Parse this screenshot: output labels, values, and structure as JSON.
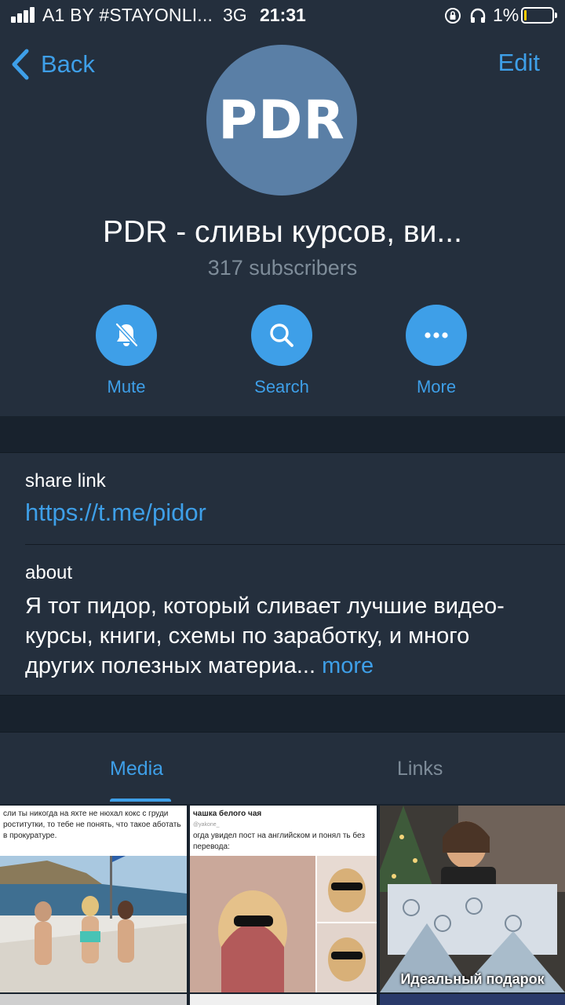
{
  "status_bar": {
    "carrier": "A1 BY #STAYONLI...",
    "network": "3G",
    "time": "21:31",
    "battery": "1%"
  },
  "header": {
    "back_label": "Back",
    "edit_label": "Edit",
    "avatar_text": "PDR",
    "title": "PDR - сливы курсов, ви...",
    "subscribers": "317 subscribers"
  },
  "actions": [
    {
      "label": "Mute",
      "icon": "bell-slash-icon"
    },
    {
      "label": "Search",
      "icon": "search-icon"
    },
    {
      "label": "More",
      "icon": "more-icon"
    }
  ],
  "info": {
    "share_caption": "share link",
    "share_url": "https://t.me/pidor",
    "about_caption": "about",
    "about_text": "Я тот пидор, который сливает лучшие видео-курсы, книги, схемы по заработку, и много других полезных материа...",
    "about_more": "more"
  },
  "tabs": {
    "media": "Media",
    "links": "Links"
  },
  "media": [
    {
      "top_text": "сли ты никогда на яхте не нюхал кокс с груди роститутки, то тебе не понять, что такое аботать в прокуратуре."
    },
    {
      "header": "чашка белого чая",
      "handle": "@yakone_",
      "top_text": "огда увидел пост на английском и понял ть без перевода:"
    },
    {
      "caption": "Идеальный подарок"
    }
  ],
  "colors": {
    "background": "#18222d",
    "panel": "#242f3d",
    "accent": "#3e9fe8",
    "secondary_text": "#7e8c99",
    "avatar": "#5a7fa6"
  }
}
